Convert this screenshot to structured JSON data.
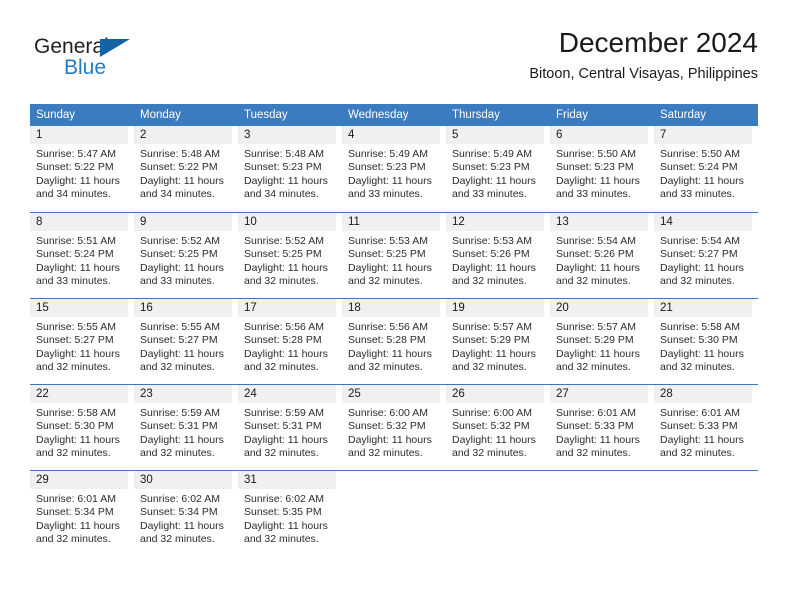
{
  "brand": {
    "word_general": "General",
    "word_blue": "Blue",
    "accent_black": "#231f20",
    "accent_blue": "#1f7dc4"
  },
  "header": {
    "title": "December 2024",
    "subtitle": "Bitoon, Central Visayas, Philippines"
  },
  "calendar": {
    "header_color": "#3b7bbf",
    "day_strip_color": "#f0f0f0",
    "weekdays": [
      "Sunday",
      "Monday",
      "Tuesday",
      "Wednesday",
      "Thursday",
      "Friday",
      "Saturday"
    ],
    "weeks": [
      [
        {
          "day": "1",
          "sunrise": "Sunrise: 5:47 AM",
          "sunset": "Sunset: 5:22 PM",
          "daylight1": "Daylight: 11 hours",
          "daylight2": "and 34 minutes."
        },
        {
          "day": "2",
          "sunrise": "Sunrise: 5:48 AM",
          "sunset": "Sunset: 5:22 PM",
          "daylight1": "Daylight: 11 hours",
          "daylight2": "and 34 minutes."
        },
        {
          "day": "3",
          "sunrise": "Sunrise: 5:48 AM",
          "sunset": "Sunset: 5:23 PM",
          "daylight1": "Daylight: 11 hours",
          "daylight2": "and 34 minutes."
        },
        {
          "day": "4",
          "sunrise": "Sunrise: 5:49 AM",
          "sunset": "Sunset: 5:23 PM",
          "daylight1": "Daylight: 11 hours",
          "daylight2": "and 33 minutes."
        },
        {
          "day": "5",
          "sunrise": "Sunrise: 5:49 AM",
          "sunset": "Sunset: 5:23 PM",
          "daylight1": "Daylight: 11 hours",
          "daylight2": "and 33 minutes."
        },
        {
          "day": "6",
          "sunrise": "Sunrise: 5:50 AM",
          "sunset": "Sunset: 5:23 PM",
          "daylight1": "Daylight: 11 hours",
          "daylight2": "and 33 minutes."
        },
        {
          "day": "7",
          "sunrise": "Sunrise: 5:50 AM",
          "sunset": "Sunset: 5:24 PM",
          "daylight1": "Daylight: 11 hours",
          "daylight2": "and 33 minutes."
        }
      ],
      [
        {
          "day": "8",
          "sunrise": "Sunrise: 5:51 AM",
          "sunset": "Sunset: 5:24 PM",
          "daylight1": "Daylight: 11 hours",
          "daylight2": "and 33 minutes."
        },
        {
          "day": "9",
          "sunrise": "Sunrise: 5:52 AM",
          "sunset": "Sunset: 5:25 PM",
          "daylight1": "Daylight: 11 hours",
          "daylight2": "and 33 minutes."
        },
        {
          "day": "10",
          "sunrise": "Sunrise: 5:52 AM",
          "sunset": "Sunset: 5:25 PM",
          "daylight1": "Daylight: 11 hours",
          "daylight2": "and 32 minutes."
        },
        {
          "day": "11",
          "sunrise": "Sunrise: 5:53 AM",
          "sunset": "Sunset: 5:25 PM",
          "daylight1": "Daylight: 11 hours",
          "daylight2": "and 32 minutes."
        },
        {
          "day": "12",
          "sunrise": "Sunrise: 5:53 AM",
          "sunset": "Sunset: 5:26 PM",
          "daylight1": "Daylight: 11 hours",
          "daylight2": "and 32 minutes."
        },
        {
          "day": "13",
          "sunrise": "Sunrise: 5:54 AM",
          "sunset": "Sunset: 5:26 PM",
          "daylight1": "Daylight: 11 hours",
          "daylight2": "and 32 minutes."
        },
        {
          "day": "14",
          "sunrise": "Sunrise: 5:54 AM",
          "sunset": "Sunset: 5:27 PM",
          "daylight1": "Daylight: 11 hours",
          "daylight2": "and 32 minutes."
        }
      ],
      [
        {
          "day": "15",
          "sunrise": "Sunrise: 5:55 AM",
          "sunset": "Sunset: 5:27 PM",
          "daylight1": "Daylight: 11 hours",
          "daylight2": "and 32 minutes."
        },
        {
          "day": "16",
          "sunrise": "Sunrise: 5:55 AM",
          "sunset": "Sunset: 5:27 PM",
          "daylight1": "Daylight: 11 hours",
          "daylight2": "and 32 minutes."
        },
        {
          "day": "17",
          "sunrise": "Sunrise: 5:56 AM",
          "sunset": "Sunset: 5:28 PM",
          "daylight1": "Daylight: 11 hours",
          "daylight2": "and 32 minutes."
        },
        {
          "day": "18",
          "sunrise": "Sunrise: 5:56 AM",
          "sunset": "Sunset: 5:28 PM",
          "daylight1": "Daylight: 11 hours",
          "daylight2": "and 32 minutes."
        },
        {
          "day": "19",
          "sunrise": "Sunrise: 5:57 AM",
          "sunset": "Sunset: 5:29 PM",
          "daylight1": "Daylight: 11 hours",
          "daylight2": "and 32 minutes."
        },
        {
          "day": "20",
          "sunrise": "Sunrise: 5:57 AM",
          "sunset": "Sunset: 5:29 PM",
          "daylight1": "Daylight: 11 hours",
          "daylight2": "and 32 minutes."
        },
        {
          "day": "21",
          "sunrise": "Sunrise: 5:58 AM",
          "sunset": "Sunset: 5:30 PM",
          "daylight1": "Daylight: 11 hours",
          "daylight2": "and 32 minutes."
        }
      ],
      [
        {
          "day": "22",
          "sunrise": "Sunrise: 5:58 AM",
          "sunset": "Sunset: 5:30 PM",
          "daylight1": "Daylight: 11 hours",
          "daylight2": "and 32 minutes."
        },
        {
          "day": "23",
          "sunrise": "Sunrise: 5:59 AM",
          "sunset": "Sunset: 5:31 PM",
          "daylight1": "Daylight: 11 hours",
          "daylight2": "and 32 minutes."
        },
        {
          "day": "24",
          "sunrise": "Sunrise: 5:59 AM",
          "sunset": "Sunset: 5:31 PM",
          "daylight1": "Daylight: 11 hours",
          "daylight2": "and 32 minutes."
        },
        {
          "day": "25",
          "sunrise": "Sunrise: 6:00 AM",
          "sunset": "Sunset: 5:32 PM",
          "daylight1": "Daylight: 11 hours",
          "daylight2": "and 32 minutes."
        },
        {
          "day": "26",
          "sunrise": "Sunrise: 6:00 AM",
          "sunset": "Sunset: 5:32 PM",
          "daylight1": "Daylight: 11 hours",
          "daylight2": "and 32 minutes."
        },
        {
          "day": "27",
          "sunrise": "Sunrise: 6:01 AM",
          "sunset": "Sunset: 5:33 PM",
          "daylight1": "Daylight: 11 hours",
          "daylight2": "and 32 minutes."
        },
        {
          "day": "28",
          "sunrise": "Sunrise: 6:01 AM",
          "sunset": "Sunset: 5:33 PM",
          "daylight1": "Daylight: 11 hours",
          "daylight2": "and 32 minutes."
        }
      ],
      [
        {
          "day": "29",
          "sunrise": "Sunrise: 6:01 AM",
          "sunset": "Sunset: 5:34 PM",
          "daylight1": "Daylight: 11 hours",
          "daylight2": "and 32 minutes."
        },
        {
          "day": "30",
          "sunrise": "Sunrise: 6:02 AM",
          "sunset": "Sunset: 5:34 PM",
          "daylight1": "Daylight: 11 hours",
          "daylight2": "and 32 minutes."
        },
        {
          "day": "31",
          "sunrise": "Sunrise: 6:02 AM",
          "sunset": "Sunset: 5:35 PM",
          "daylight1": "Daylight: 11 hours",
          "daylight2": "and 32 minutes."
        },
        {
          "day": "",
          "sunrise": "",
          "sunset": "",
          "daylight1": "",
          "daylight2": ""
        },
        {
          "day": "",
          "sunrise": "",
          "sunset": "",
          "daylight1": "",
          "daylight2": ""
        },
        {
          "day": "",
          "sunrise": "",
          "sunset": "",
          "daylight1": "",
          "daylight2": ""
        },
        {
          "day": "",
          "sunrise": "",
          "sunset": "",
          "daylight1": "",
          "daylight2": ""
        }
      ]
    ]
  }
}
